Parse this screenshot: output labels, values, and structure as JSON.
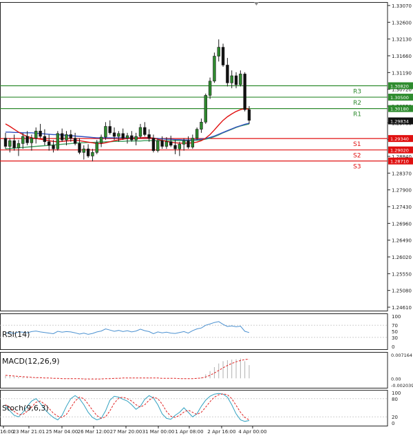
{
  "chart_data": {
    "type": "candlestick",
    "main_panel": {
      "price_ticks": [
        "1.33070",
        "1.32600",
        "1.32130",
        "1.31660",
        "1.31190",
        "1.30720",
        "1.30250",
        "1.29780",
        "1.29310",
        "1.28840",
        "1.28370",
        "1.27900",
        "1.27430",
        "1.26960",
        "1.26490",
        "1.26020",
        "1.25550",
        "1.25080",
        "1.24610"
      ],
      "ylim": [
        1.2461,
        1.3307
      ],
      "current_price": "1.29834",
      "levels": [
        {
          "name": "R3",
          "price": 1.3082,
          "price_label": "1.30820",
          "kind": "resistance",
          "color": "#2e8b2e"
        },
        {
          "name": "R2",
          "price": 1.305,
          "price_label": "1.30500",
          "kind": "resistance",
          "color": "#2e8b2e"
        },
        {
          "name": "R1",
          "price": 1.3018,
          "price_label": "1.30180",
          "kind": "resistance",
          "color": "#2e8b2e"
        },
        {
          "name": "S1",
          "price": 1.2934,
          "price_label": "1.29340",
          "kind": "support",
          "color": "#e01010"
        },
        {
          "name": "S2",
          "price": 1.2902,
          "price_label": "1.29020",
          "kind": "support",
          "color": "#e01010"
        },
        {
          "name": "S3",
          "price": 1.2871,
          "price_label": "1.28710",
          "kind": "support",
          "color": "#e01010"
        }
      ],
      "candles": [
        [
          1.2935,
          1.295,
          1.2905,
          1.2912
        ],
        [
          1.2912,
          1.2935,
          1.2895,
          1.2928
        ],
        [
          1.2928,
          1.2945,
          1.29,
          1.2908
        ],
        [
          1.2908,
          1.293,
          1.2885,
          1.292
        ],
        [
          1.292,
          1.295,
          1.2905,
          1.294
        ],
        [
          1.294,
          1.2955,
          1.2915,
          1.2922
        ],
        [
          1.2922,
          1.2945,
          1.29,
          1.2935
        ],
        [
          1.2935,
          1.2965,
          1.292,
          1.2955
        ],
        [
          1.2955,
          1.2975,
          1.2935,
          1.294
        ],
        [
          1.294,
          1.296,
          1.2915,
          1.2925
        ],
        [
          1.2925,
          1.2945,
          1.29,
          1.2915
        ],
        [
          1.2915,
          1.293,
          1.2895,
          1.2905
        ],
        [
          1.2905,
          1.2955,
          1.29,
          1.2948
        ],
        [
          1.2948,
          1.2962,
          1.2925,
          1.293
        ],
        [
          1.293,
          1.2955,
          1.2915,
          1.2945
        ],
        [
          1.2945,
          1.2958,
          1.2925,
          1.2935
        ],
        [
          1.2935,
          1.295,
          1.2915,
          1.292
        ],
        [
          1.292,
          1.2935,
          1.289,
          1.2895
        ],
        [
          1.2895,
          1.2915,
          1.2875,
          1.2905
        ],
        [
          1.2905,
          1.2918,
          1.288,
          1.2885
        ],
        [
          1.2885,
          1.2905,
          1.287,
          1.2895
        ],
        [
          1.2895,
          1.293,
          1.289,
          1.2922
        ],
        [
          1.2922,
          1.2945,
          1.291,
          1.2938
        ],
        [
          1.2938,
          1.298,
          1.293,
          1.2968
        ],
        [
          1.2968,
          1.2985,
          1.2945,
          1.295
        ],
        [
          1.295,
          1.2965,
          1.293,
          1.294
        ],
        [
          1.294,
          1.2955,
          1.2925,
          1.2948
        ],
        [
          1.2948,
          1.2962,
          1.293,
          1.2935
        ],
        [
          1.2935,
          1.295,
          1.292,
          1.2942
        ],
        [
          1.2942,
          1.2955,
          1.2925,
          1.293
        ],
        [
          1.293,
          1.295,
          1.2915,
          1.294
        ],
        [
          1.294,
          1.2975,
          1.2935,
          1.2965
        ],
        [
          1.2965,
          1.298,
          1.294,
          1.2945
        ],
        [
          1.2945,
          1.296,
          1.2925,
          1.2935
        ],
        [
          1.2935,
          1.2945,
          1.2895,
          1.29
        ],
        [
          1.29,
          1.2935,
          1.2895,
          1.2928
        ],
        [
          1.2928,
          1.294,
          1.2905,
          1.2912
        ],
        [
          1.2912,
          1.2938,
          1.2905,
          1.2925
        ],
        [
          1.2925,
          1.2942,
          1.291,
          1.2915
        ],
        [
          1.2915,
          1.293,
          1.289,
          1.2905
        ],
        [
          1.2905,
          1.2925,
          1.2885,
          1.2918
        ],
        [
          1.2918,
          1.2935,
          1.29,
          1.2928
        ],
        [
          1.2928,
          1.294,
          1.2905,
          1.291
        ],
        [
          1.291,
          1.2945,
          1.2905,
          1.2935
        ],
        [
          1.2935,
          1.2965,
          1.293,
          1.296
        ],
        [
          1.296,
          1.299,
          1.295,
          1.298
        ],
        [
          1.298,
          1.306,
          1.2975,
          1.3055
        ],
        [
          1.3055,
          1.3105,
          1.3045,
          1.3095
        ],
        [
          1.3095,
          1.3175,
          1.309,
          1.3165
        ],
        [
          1.3165,
          1.3212,
          1.315,
          1.319
        ],
        [
          1.319,
          1.32,
          1.3135,
          1.314
        ],
        [
          1.314,
          1.316,
          1.308,
          1.309
        ],
        [
          1.309,
          1.3125,
          1.3075,
          1.311
        ],
        [
          1.311,
          1.312,
          1.3075,
          1.3085
        ],
        [
          1.3085,
          1.3125,
          1.308,
          1.3115
        ],
        [
          1.3115,
          1.312,
          1.301,
          1.3015
        ],
        [
          1.3015,
          1.3025,
          1.2975,
          1.2985
        ]
      ],
      "ma_red": [
        1.2975,
        1.2968,
        1.296,
        1.2952,
        1.2945,
        1.294,
        1.2936,
        1.2934,
        1.2932,
        1.293,
        1.2928,
        1.2926,
        1.2925,
        1.2926,
        1.2927,
        1.2928,
        1.2929,
        1.2928,
        1.2926,
        1.2924,
        1.2922,
        1.292,
        1.292,
        1.2922,
        1.2925,
        1.2928,
        1.293,
        1.2932,
        1.2934,
        1.2935,
        1.2935,
        1.2936,
        1.2937,
        1.2937,
        1.2935,
        1.2932,
        1.2929,
        1.2926,
        1.2924,
        1.2922,
        1.2921,
        1.2921,
        1.2921,
        1.2922,
        1.2924,
        1.2928,
        1.2935,
        1.2945,
        1.2958,
        1.2972,
        1.2985,
        1.2995,
        1.3003,
        1.301,
        1.3015,
        1.3018,
        1.3016
      ],
      "ma_blue": [
        1.2952,
        1.2952,
        1.2951,
        1.2951,
        1.295,
        1.295,
        1.295,
        1.2949,
        1.2948,
        1.2947,
        1.2946,
        1.2945,
        1.2945,
        1.2944,
        1.2943,
        1.2942,
        1.2941,
        1.294,
        1.2939,
        1.2938,
        1.2937,
        1.2936,
        1.2936,
        1.2936,
        1.2936,
        1.2936,
        1.2936,
        1.2936,
        1.2936,
        1.2936,
        1.2936,
        1.2936,
        1.2936,
        1.2936,
        1.2935,
        1.2934,
        1.2933,
        1.2932,
        1.2932,
        1.2931,
        1.2931,
        1.293,
        1.293,
        1.293,
        1.2931,
        1.2932,
        1.2934,
        1.2937,
        1.2941,
        1.2946,
        1.2951,
        1.2956,
        1.2961,
        1.2966,
        1.297,
        1.2974,
        1.2977
      ],
      "ma_green": [
        1.2905,
        1.2906,
        1.2907,
        1.2908,
        1.2909,
        1.291,
        1.2911,
        1.2912,
        1.2913,
        1.2914,
        1.2915,
        1.2916,
        1.2917,
        1.2918,
        1.2919,
        1.292,
        1.2921,
        1.2922,
        1.2922,
        1.2923,
        1.2923,
        1.2924,
        1.2924,
        1.2925,
        1.2925,
        1.2926,
        1.2926,
        1.2926,
        1.2927,
        1.2927,
        1.2927,
        1.2927,
        1.2928,
        1.2928,
        1.2928,
        1.2928,
        1.2928,
        1.2928,
        1.2928,
        1.2928,
        1.2928,
        1.2928,
        1.2928,
        1.2929,
        1.2929,
        1.293,
        1.2932,
        1.2935,
        1.2939,
        1.2944,
        1.295,
        1.2955,
        1.296,
        1.2965,
        1.2969,
        1.2972,
        1.2975
      ]
    },
    "rsi_panel": {
      "label": "RSI(14)",
      "ticks": [
        "100",
        "70",
        "50",
        "30",
        "0"
      ],
      "ylim": [
        0,
        100
      ],
      "values": [
        44,
        46,
        43,
        48,
        47,
        45,
        49,
        51,
        48,
        46,
        44,
        42,
        50,
        47,
        49,
        48,
        45,
        41,
        44,
        40,
        43,
        48,
        51,
        58,
        54,
        50,
        53,
        49,
        52,
        48,
        51,
        57,
        52,
        49,
        42,
        48,
        45,
        47,
        44,
        43,
        46,
        49,
        44,
        52,
        58,
        61,
        70,
        74,
        79,
        82,
        73,
        66,
        68,
        65,
        67,
        50,
        46
      ]
    },
    "macd_panel": {
      "label": "MACD(12,26,9)",
      "ticks": [
        "0.007164",
        "0.00",
        "-0.002039"
      ],
      "ylim": [
        -0.002039,
        0.007164
      ],
      "histogram": [
        0.0008,
        0.0007,
        0.0006,
        0.0005,
        0.0004,
        0.0003,
        0.0002,
        0.0002,
        0.0001,
        0.0001,
        0.0,
        -0.0001,
        -0.0001,
        -0.0001,
        -0.0001,
        -0.0001,
        -0.0001,
        -0.0002,
        -0.0002,
        -0.0002,
        -0.0002,
        -0.0002,
        -0.0001,
        0.0,
        0.0001,
        0.0001,
        0.0001,
        0.0001,
        0.0001,
        0.0001,
        0.0001,
        0.0002,
        0.0002,
        0.0001,
        0.0,
        0.0,
        0.0,
        0.0,
        0.0,
        -0.0001,
        -0.0001,
        -0.0001,
        -0.0001,
        0.0,
        0.0001,
        0.0003,
        0.0012,
        0.0022,
        0.0034,
        0.0045,
        0.0052,
        0.0055,
        0.0057,
        0.0058,
        0.006,
        0.0052,
        0.004
      ],
      "signal": [
        0.0009,
        0.0008,
        0.0007,
        0.0006,
        0.0005,
        0.0004,
        0.0003,
        0.0002,
        0.0002,
        0.0001,
        0.0001,
        0.0,
        0.0,
        -0.0001,
        -0.0001,
        -0.0001,
        -0.0001,
        -0.0001,
        -0.0002,
        -0.0002,
        -0.0002,
        -0.0002,
        -0.0002,
        -0.0001,
        -0.0001,
        0.0,
        0.0,
        0.0001,
        0.0001,
        0.0001,
        0.0001,
        0.0001,
        0.0001,
        0.0001,
        0.0001,
        0.0001,
        0.0,
        0.0,
        0.0,
        0.0,
        -0.0001,
        -0.0001,
        -0.0001,
        -0.0001,
        0.0,
        0.0001,
        0.0004,
        0.0009,
        0.0016,
        0.0024,
        0.0032,
        0.0039,
        0.0045,
        0.005,
        0.0054,
        0.0057,
        0.0058
      ]
    },
    "stoch_panel": {
      "label": "Stoch(9,6,3)",
      "ticks": [
        "100",
        "80",
        "20",
        "0"
      ],
      "ylim": [
        0,
        100
      ],
      "k": [
        55,
        40,
        25,
        20,
        35,
        55,
        72,
        80,
        65,
        45,
        30,
        18,
        10,
        25,
        55,
        80,
        90,
        80,
        60,
        35,
        18,
        10,
        15,
        40,
        75,
        88,
        85,
        78,
        72,
        60,
        45,
        55,
        78,
        90,
        82,
        60,
        30,
        15,
        12,
        25,
        35,
        50,
        35,
        20,
        30,
        55,
        75,
        88,
        95,
        97,
        95,
        85,
        60,
        30,
        10,
        5,
        8
      ],
      "d": [
        60,
        50,
        38,
        28,
        28,
        38,
        52,
        68,
        72,
        62,
        48,
        32,
        22,
        18,
        28,
        50,
        72,
        85,
        80,
        62,
        42,
        24,
        15,
        20,
        40,
        65,
        82,
        85,
        80,
        72,
        60,
        52,
        60,
        75,
        85,
        80,
        62,
        38,
        22,
        18,
        25,
        36,
        42,
        35,
        28,
        35,
        52,
        70,
        85,
        93,
        96,
        93,
        80,
        58,
        35,
        18,
        10
      ]
    },
    "x_ticks": [
      "16:00",
      "23 Mar 21:01",
      "25 Mar 04:00",
      "26 Mar 12:00",
      "27 Mar 20:00",
      "31 Mar 00:00",
      "1 Apr 08:00",
      "2 Apr 16:00",
      "4 Apr 00:00"
    ],
    "colors": {
      "bull_fill": "#ffffff",
      "bear_fill": "#111111",
      "candle_body_bull": "#2e8b2e",
      "candle_outline": "#1a5e1a",
      "ma_red": "#e01010",
      "ma_blue": "#3050c0",
      "ma_green": "#40a060",
      "rsi_line": "#4a90d0",
      "macd_hist": "#b0b0b0",
      "macd_signal": "#e02020",
      "stoch_k": "#30a0c0",
      "stoch_d": "#e02020"
    }
  }
}
